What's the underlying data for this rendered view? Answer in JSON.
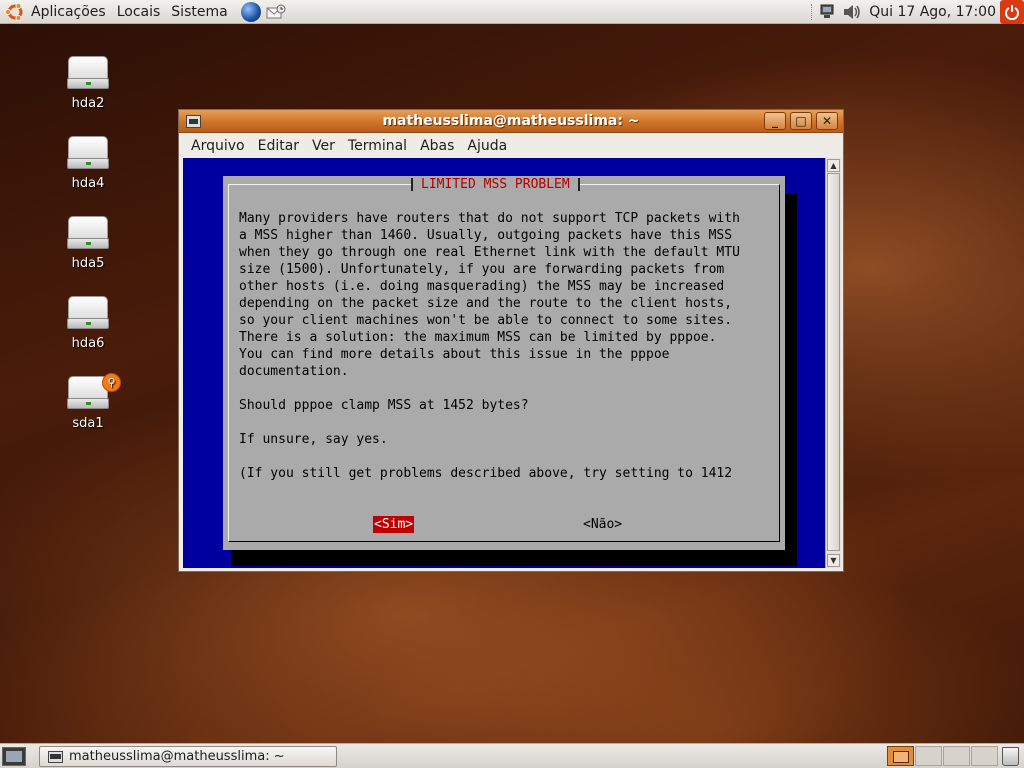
{
  "top_panel": {
    "menus": [
      "Aplicações",
      "Locais",
      "Sistema"
    ],
    "clock": "Qui 17 Ago, 17:00"
  },
  "desktop": {
    "icons": [
      {
        "label": "hda2",
        "type": "drive"
      },
      {
        "label": "hda4",
        "type": "drive"
      },
      {
        "label": "hda5",
        "type": "drive"
      },
      {
        "label": "hda6",
        "type": "drive"
      },
      {
        "label": "sda1",
        "type": "usb-drive"
      }
    ]
  },
  "terminal": {
    "title": "matheusslima@matheusslima: ~",
    "menu": [
      "Arquivo",
      "Editar",
      "Ver",
      "Terminal",
      "Abas",
      "Ajuda"
    ],
    "dialog": {
      "title": "LIMITED MSS PROBLEM",
      "lines": [
        "Many providers have routers that do not support TCP packets with",
        "a MSS higher than 1460. Usually, outgoing packets have this MSS",
        "when they go through one real Ethernet link with the default MTU",
        "size (1500). Unfortunately, if you are forwarding packets from",
        "other hosts (i.e. doing masquerading) the MSS may be increased",
        "depending on the packet size and the route to the client hosts,",
        "so your client machines won't be able to connect to some sites.",
        "There is a solution: the maximum MSS can be limited by pppoe.",
        "You can find more details about this issue in the pppoe",
        "documentation.",
        "",
        "Should pppoe clamp MSS at 1452 bytes?",
        "",
        "If unsure, say yes.",
        "",
        "(If you still get problems described above, try setting to 1412"
      ],
      "yes_label": "<Sim>",
      "no_label": "<Não>"
    }
  },
  "taskbar": {
    "window_label": "matheusslima@matheusslima: ~",
    "workspace_count": 4,
    "active_workspace": 1
  },
  "colors": {
    "terminal_bg": "#00009f",
    "dialog_bg": "#aaaaaa",
    "dialog_title": "#b00000",
    "selected_button": "#c00000",
    "titlebar": "#cf7329"
  }
}
